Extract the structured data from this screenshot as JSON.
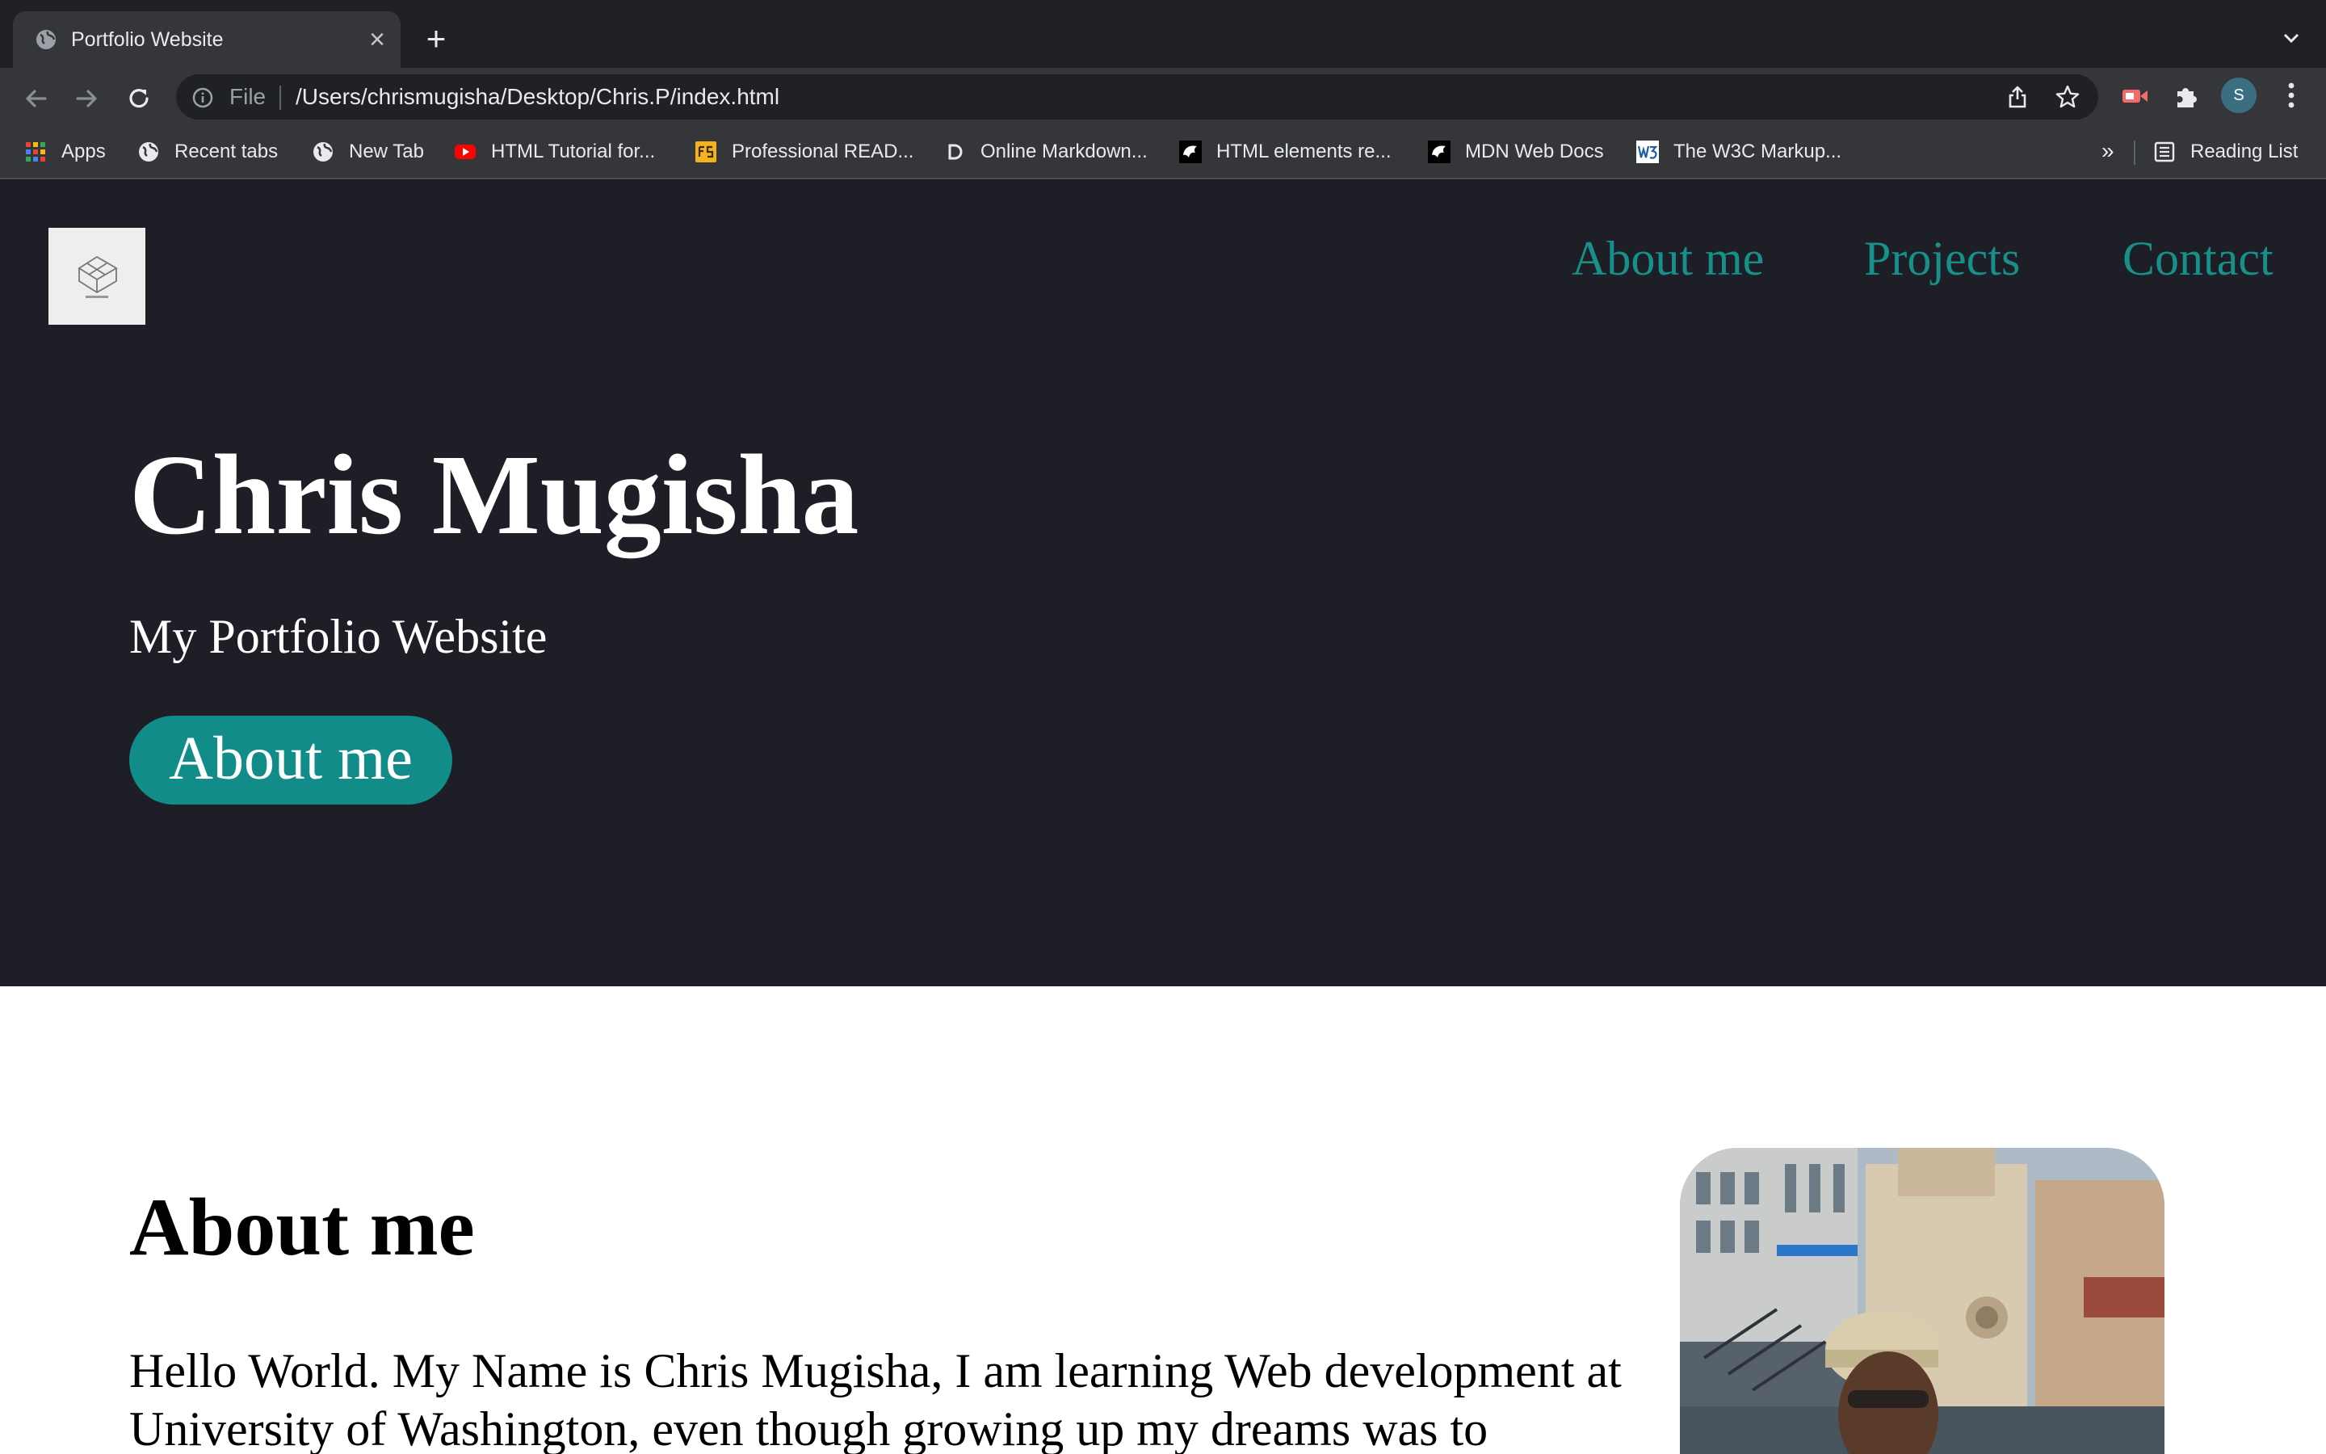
{
  "browser": {
    "tab": {
      "title": "Portfolio Website",
      "close_glyph": "×",
      "favicon": "globe-icon"
    },
    "new_tab_glyph": "+",
    "omnibox": {
      "scheme": "File",
      "url": "/Users/chrismugisha/Desktop/Chris.P/index.html"
    },
    "profile_initial": "S",
    "bookmarks": [
      {
        "label": "Apps",
        "icon": "apps-grid-icon"
      },
      {
        "label": "Recent tabs",
        "icon": "globe-icon"
      },
      {
        "label": "New Tab",
        "icon": "globe-icon"
      },
      {
        "label": "HTML Tutorial for...",
        "icon": "youtube-icon"
      },
      {
        "label": "Professional READ...",
        "icon": "fs-icon"
      },
      {
        "label": "Online Markdown...",
        "icon": "d-letter-icon"
      },
      {
        "label": "HTML elements re...",
        "icon": "mdn-icon"
      },
      {
        "label": "MDN Web Docs",
        "icon": "mdn-icon"
      },
      {
        "label": "The W3C Markup...",
        "icon": "w3c-icon"
      }
    ],
    "bookmarks_overflow": "»",
    "reading_list": "Reading List",
    "colors": {
      "frame": "#202124",
      "toolbar": "#35363a",
      "text": "#e8eaed"
    }
  },
  "page": {
    "nav": [
      "About me",
      "Projects",
      "Contact"
    ],
    "hero": {
      "name": "Chris Mugisha",
      "subtitle": "My Portfolio Website",
      "button": "About me"
    },
    "about": {
      "title": "About me",
      "text": "Hello World. My Name is Chris Mugisha, I am learning Web development at University of Washington, even though growing up my dreams was to"
    },
    "colors": {
      "hero_bg": "#1e1e26",
      "accent": "#128c89",
      "nav_link": "#179089",
      "about_bg": "#ffffff"
    }
  }
}
